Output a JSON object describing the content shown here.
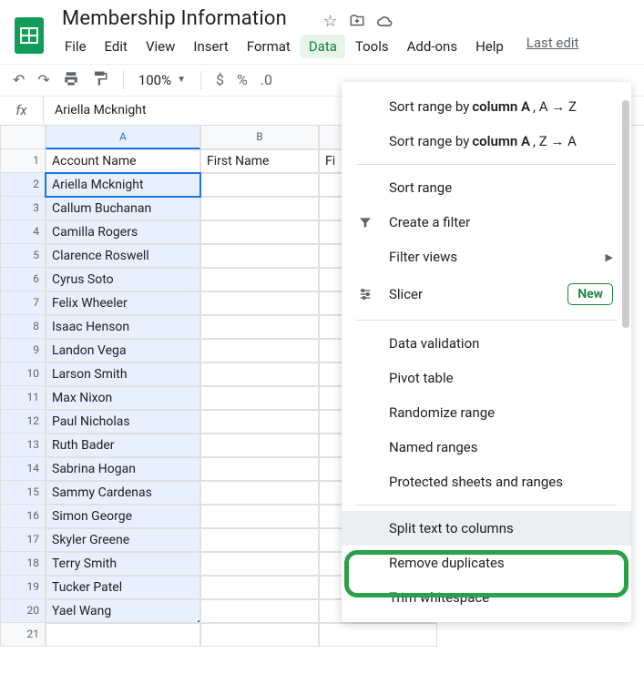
{
  "doc_title": "Membership Information",
  "menubar": {
    "file": "File",
    "edit": "Edit",
    "view": "View",
    "insert": "Insert",
    "format": "Format",
    "data": "Data",
    "tools": "Tools",
    "addons": "Add-ons",
    "help": "Help",
    "last_edit": "Last edit"
  },
  "toolbar": {
    "zoom": "100%",
    "currency": "$",
    "percent": "%",
    "decimal": ".0"
  },
  "formula_bar": {
    "fx": "fx",
    "content": "Ariella Mcknight"
  },
  "columns": [
    "A",
    "B"
  ],
  "headers": {
    "A": "Account Name",
    "B": "First Name",
    "C_partial": "Fi"
  },
  "rows": [
    "Ariella Mcknight",
    "Callum Buchanan",
    "Camilla Rogers",
    "Clarence Roswell",
    "Cyrus Soto",
    "Felix Wheeler",
    "Isaac Henson",
    "Landon Vega",
    "Larson Smith",
    "Max Nixon",
    "Paul Nicholas",
    "Ruth Bader",
    "Sabrina Hogan",
    "Sammy Cardenas",
    "Simon George",
    "Skyler Greene",
    "Terry Smith",
    "Tucker Patel",
    "Yael Wang"
  ],
  "dropdown": {
    "sort_az_pre": "Sort range by ",
    "sort_col": "column A",
    "sort_az_suf": ", A → Z",
    "sort_za_suf": ", Z → A",
    "sort_range": "Sort range",
    "create_filter": "Create a filter",
    "filter_views": "Filter views",
    "slicer": "Slicer",
    "slicer_badge": "New",
    "data_validation": "Data validation",
    "pivot_table": "Pivot table",
    "randomize": "Randomize range",
    "named_ranges": "Named ranges",
    "protected": "Protected sheets and ranges",
    "split_text": "Split text to columns",
    "remove_dup": "Remove duplicates",
    "trim_ws": "Trim whitespace"
  }
}
